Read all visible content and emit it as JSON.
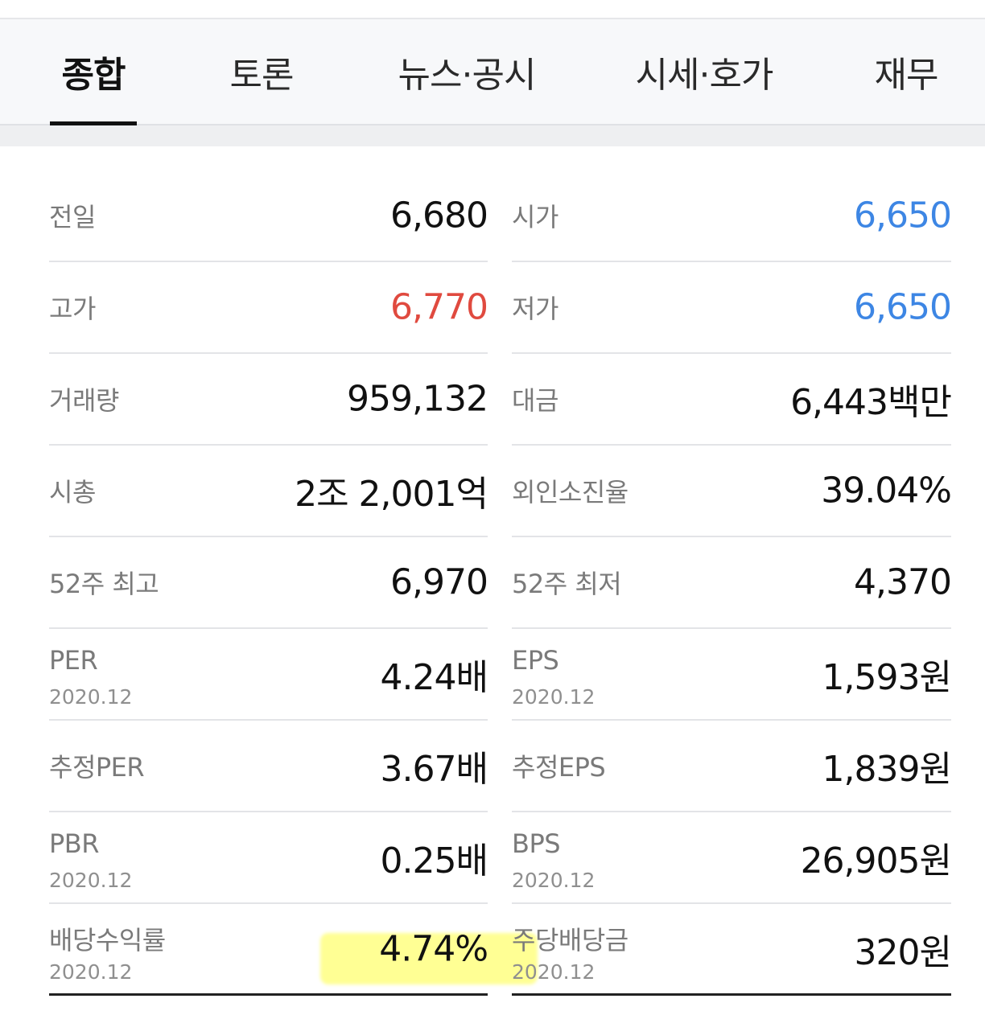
{
  "tabs": [
    {
      "label": "종합",
      "active": true
    },
    {
      "label": "토론",
      "active": false
    },
    {
      "label": "뉴스·공시",
      "active": false
    },
    {
      "label": "시세·호가",
      "active": false
    },
    {
      "label": "재무",
      "active": false
    }
  ],
  "colors": {
    "up": "#e04a3f",
    "down": "#3d86e4",
    "highlight": "#ffff3c"
  },
  "rows": [
    {
      "left": {
        "label": "전일",
        "value": "6,680"
      },
      "right": {
        "label": "시가",
        "value": "6,650",
        "color": "down"
      }
    },
    {
      "left": {
        "label": "고가",
        "value": "6,770",
        "color": "up"
      },
      "right": {
        "label": "저가",
        "value": "6,650",
        "color": "down"
      }
    },
    {
      "left": {
        "label": "거래량",
        "value": "959,132"
      },
      "right": {
        "label": "대금",
        "value": "6,443백만"
      }
    },
    {
      "left": {
        "label": "시총",
        "value": "2조 2,001억"
      },
      "right": {
        "label": "외인소진율",
        "value": "39.04%"
      }
    },
    {
      "left": {
        "label": "52주 최고",
        "value": "6,970"
      },
      "right": {
        "label": "52주 최저",
        "value": "4,370"
      }
    },
    {
      "left": {
        "label": "PER",
        "sub": "2020.12",
        "value": "4.24배"
      },
      "right": {
        "label": "EPS",
        "sub": "2020.12",
        "value": "1,593원"
      }
    },
    {
      "left": {
        "label": "추정PER",
        "value": "3.67배"
      },
      "right": {
        "label": "추정EPS",
        "value": "1,839원"
      }
    },
    {
      "left": {
        "label": "PBR",
        "sub": "2020.12",
        "value": "0.25배"
      },
      "right": {
        "label": "BPS",
        "sub": "2020.12",
        "value": "26,905원"
      }
    },
    {
      "left": {
        "label": "배당수익률",
        "sub": "2020.12",
        "value": "4.74%"
      },
      "right": {
        "label": "주당배당금",
        "sub": "2020.12",
        "value": "320원"
      }
    }
  ]
}
